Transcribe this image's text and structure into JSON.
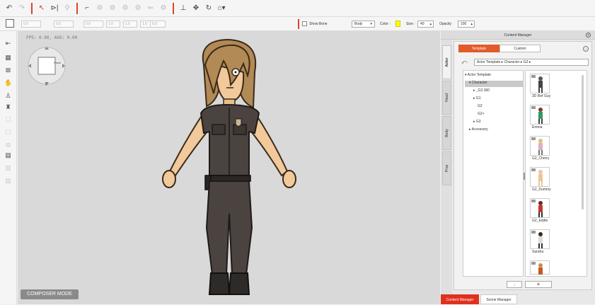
{
  "viewport": {
    "fps_text": "FPS: 0.00, AVG: 0.00",
    "navcube_label": "Front",
    "navcube_angle": "0°",
    "mode_label": "COMPOSER MODE"
  },
  "toolbar2": {
    "fields": [
      "0.0",
      "0.0",
      "0.0",
      "1.0",
      "1.0",
      "1.0",
      "0.0",
      "0.0"
    ],
    "show_bones_label": "Show Bone",
    "body_select": "Body",
    "color_label": "Color :",
    "color_value": "#ffff00",
    "size_label": "Size :",
    "size_value": "40",
    "opacity_label": "Opacity",
    "opacity_value": "100"
  },
  "content_manager": {
    "title": "Content Manager",
    "vertical_tabs": [
      "Actor",
      "Head",
      "Body",
      "Prop"
    ],
    "tabs": [
      "Template",
      "Custom"
    ],
    "path": "Actor Template ▸ Character ▸ G2 ▸",
    "tree": {
      "root": "Actor Template",
      "character": "Character",
      "children": [
        "_G3 360",
        "G1",
        "G2",
        "G2+",
        "G3"
      ],
      "accessory": "Accessory"
    },
    "thumbnails": [
      "3D Ref Guy",
      "Emma",
      "G2_Cherry",
      "G2_Dummy",
      "G2_Eddie",
      "Sandra"
    ],
    "bottom_buttons": {
      "down": "↓",
      "add": "+"
    }
  },
  "panel_tabs": [
    "Content Manager",
    "Scene Manager"
  ]
}
